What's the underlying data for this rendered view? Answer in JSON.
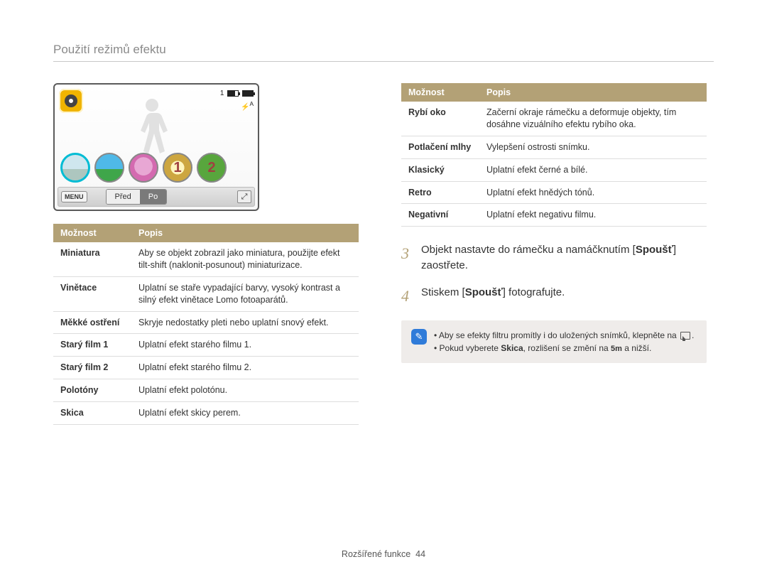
{
  "page_title": "Použití režimů efektu",
  "footer": {
    "section": "Rozšířené funkce",
    "page": "44"
  },
  "screen": {
    "count": "1",
    "flash_label": "A",
    "menu_label": "MENU",
    "before_label": "Před",
    "after_label": "Po",
    "thumb4_num": "1",
    "thumb5_num": "2"
  },
  "left_table": {
    "header_option": "Možnost",
    "header_desc": "Popis",
    "rows": [
      {
        "name": "Miniatura",
        "desc": "Aby se objekt zobrazil jako miniatura, použijte efekt tilt-shift (naklonit-posunout) miniaturizace."
      },
      {
        "name": "Vinětace",
        "desc": "Uplatní se staře vypadající barvy, vysoký kontrast a silný efekt vinětace Lomo fotoaparátů."
      },
      {
        "name": "Měkké ostření",
        "desc": "Skryje nedostatky pleti nebo uplatní snový efekt."
      },
      {
        "name": "Starý film 1",
        "desc": "Uplatní efekt starého filmu 1."
      },
      {
        "name": "Starý film 2",
        "desc": "Uplatní efekt starého filmu 2."
      },
      {
        "name": "Polotóny",
        "desc": "Uplatní efekt polotónu."
      },
      {
        "name": "Skica",
        "desc": "Uplatní efekt skicy perem."
      }
    ]
  },
  "right_table": {
    "header_option": "Možnost",
    "header_desc": "Popis",
    "rows": [
      {
        "name": "Rybí oko",
        "desc": "Začerní okraje rámečku a deformuje objekty, tím dosáhne vizuálního efektu rybího oka."
      },
      {
        "name": "Potlačení mlhy",
        "desc": "Vylepšení ostrosti snímku."
      },
      {
        "name": "Klasický",
        "desc": "Uplatní efekt černé a bílé."
      },
      {
        "name": "Retro",
        "desc": "Uplatní efekt hnědých tónů."
      },
      {
        "name": "Negativní",
        "desc": "Uplatní efekt negativu filmu."
      }
    ]
  },
  "steps": [
    {
      "num": "3",
      "pre": "Objekt nastavte do rámečku a namáčknutím [",
      "bold": "Spoušť",
      "post": "] zaostřete."
    },
    {
      "num": "4",
      "pre": "Stiskem [",
      "bold": "Spoušť",
      "post": "] fotografujte."
    }
  ],
  "note": {
    "line1_pre": "Aby se efekty filtru promítly i do uložených snímků, klepněte na ",
    "line1_post": ".",
    "line2_pre": "Pokud vyberete ",
    "line2_bold": "Skica",
    "line2_mid": ", rozlišení se změní na ",
    "line2_res": "5m",
    "line2_post": " a nižší."
  }
}
